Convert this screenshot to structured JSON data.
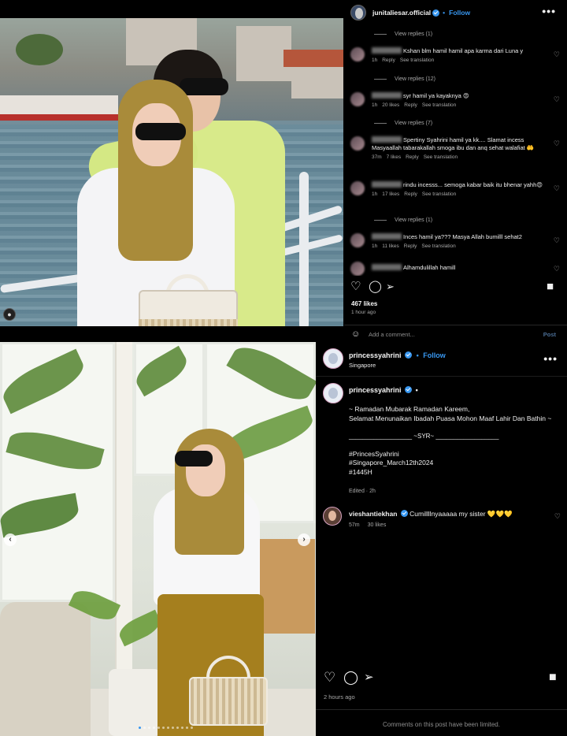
{
  "top_post": {
    "username": "junitaliesar.official",
    "follow_label": "Follow",
    "more_label": "•••",
    "comments": [
      {
        "type": "replies",
        "label": "View replies (1)"
      },
      {
        "type": "comment",
        "text": "Kshan blm hamil hamil apa karma dari Luna y",
        "time": "1h",
        "likes": "",
        "reply": "Reply",
        "translate": "See translation"
      },
      {
        "type": "replies",
        "label": "View replies (12)"
      },
      {
        "type": "comment",
        "text": "syr hamil ya kayaknya 😍",
        "time": "1h",
        "likes": "20 likes",
        "reply": "Reply",
        "translate": "See translation"
      },
      {
        "type": "replies",
        "label": "View replies (7)"
      },
      {
        "type": "comment",
        "text": "Spertiny Syahrini hamil ya kk.... Slamat incess Masyaallah tabarakallah smoga ibu dan anq sehat walafiat 🤲",
        "time": "37m",
        "likes": "7 likes",
        "reply": "Reply",
        "translate": "See translation"
      },
      {
        "type": "comment",
        "text": "rindu incesss... semoga kabar baik itu bhenar yahh😍",
        "time": "1h",
        "likes": "17 likes",
        "reply": "Reply",
        "translate": "See translation"
      },
      {
        "type": "replies",
        "label": "View replies (1)"
      },
      {
        "type": "comment",
        "text": "Inces hamil ya??? Masya Allah bumilll sehat2",
        "time": "1h",
        "likes": "11 likes",
        "reply": "Reply",
        "translate": "See translation"
      },
      {
        "type": "comment",
        "text": "Alhamdulillah hamill",
        "time": "",
        "likes": "",
        "reply": "",
        "translate": ""
      }
    ],
    "likes": "467 likes",
    "time": "1 hour ago",
    "add_comment_placeholder": "Add a comment...",
    "post_label": "Post"
  },
  "bottom_post": {
    "username": "princessyahrini",
    "follow_label": "Follow",
    "location": "Singapore",
    "more_label": "•••",
    "caption_lines": [
      "~ Ramadan Mubarak Ramadan Kareem,",
      "Selamat Menunaikan Ibadah Puasa Mohon Maaf Lahir Dan Bathin ~",
      "",
      "__________________ ~SYR~ __________________",
      "",
      "#PrincesSyahrini",
      "#Singapore_March12th2024",
      "#1445H"
    ],
    "edited": "Edited · 2h",
    "comment": {
      "username": "vieshantiekhan",
      "text": "Cumillllnyaaaaa my sister 💛💛💛",
      "time": "57m",
      "likes": "30 likes"
    },
    "time": "2 hours ago",
    "limited_notice": "Comments on this post have been limited."
  }
}
